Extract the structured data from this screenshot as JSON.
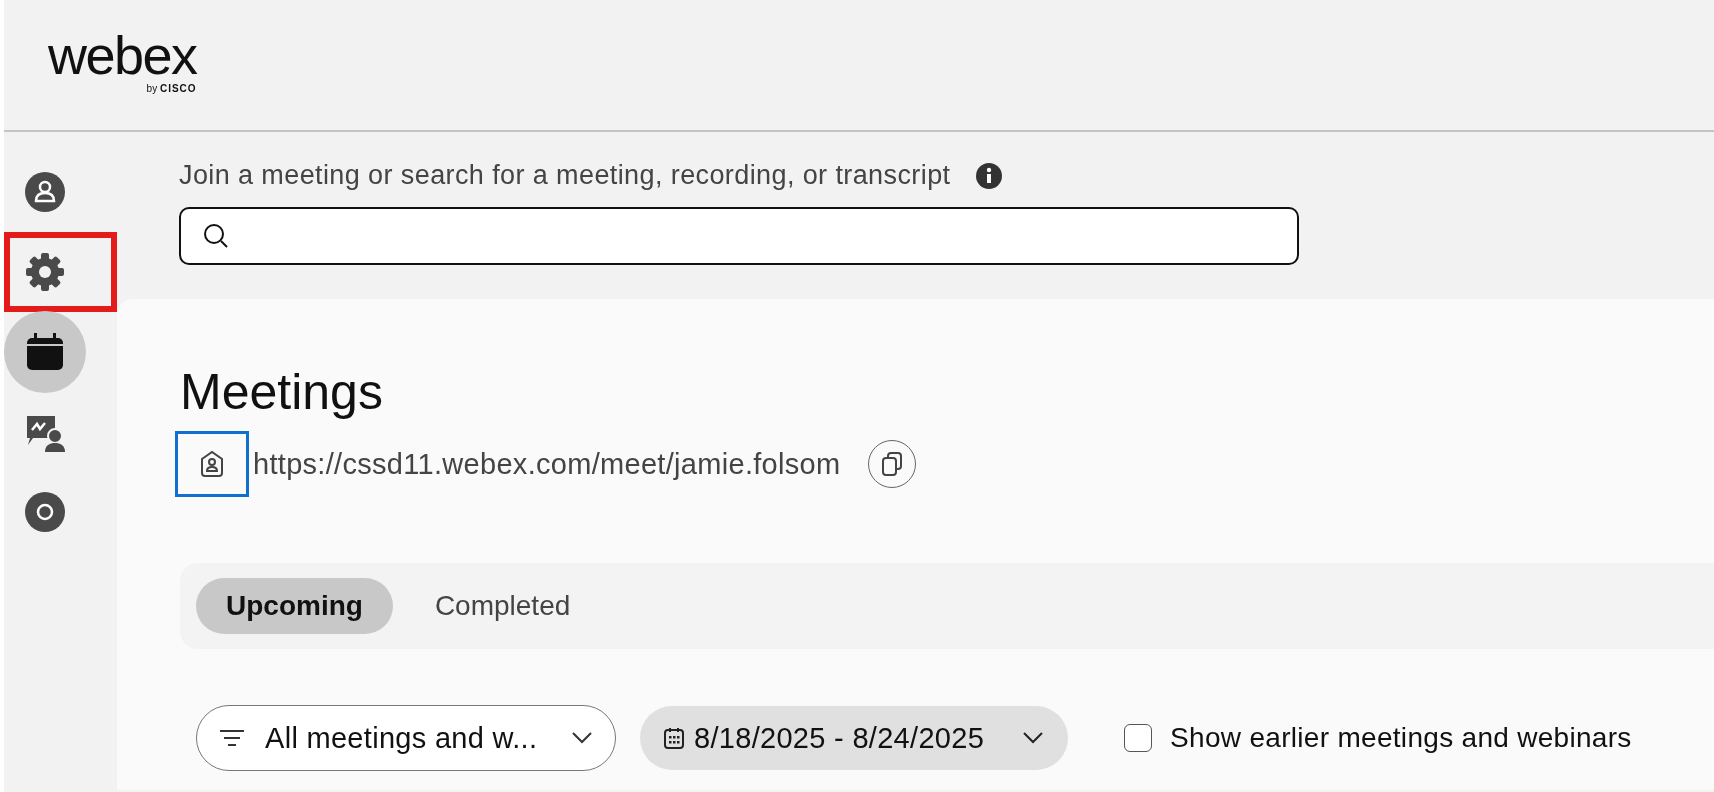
{
  "logo": {
    "name": "webex",
    "byline": "by",
    "brand": "CISCO"
  },
  "sidebar": {
    "items": [
      {
        "kind": "avatar",
        "selected": false,
        "highlighted": false
      },
      {
        "kind": "settings",
        "selected": false,
        "highlighted": true
      },
      {
        "kind": "calendar",
        "selected": true,
        "highlighted": false
      },
      {
        "kind": "chat",
        "selected": false,
        "highlighted": false
      },
      {
        "kind": "ring",
        "selected": false,
        "highlighted": false
      }
    ]
  },
  "search": {
    "label": "Join a meeting or search for a meeting, recording, or transcript"
  },
  "title": "Meetings",
  "room_link": {
    "url": "https://cssd11.webex.com/meet/jamie.folsom",
    "highlighted": true
  },
  "tabs": [
    {
      "label": "Upcoming",
      "selected": true
    },
    {
      "label": "Completed",
      "selected": false
    }
  ],
  "filters": {
    "type": "All meetings and w...",
    "date_range": "8/18/2025 - 8/24/2025",
    "show_earlier": {
      "label": "Show earlier meetings and webinars",
      "checked": false
    }
  }
}
